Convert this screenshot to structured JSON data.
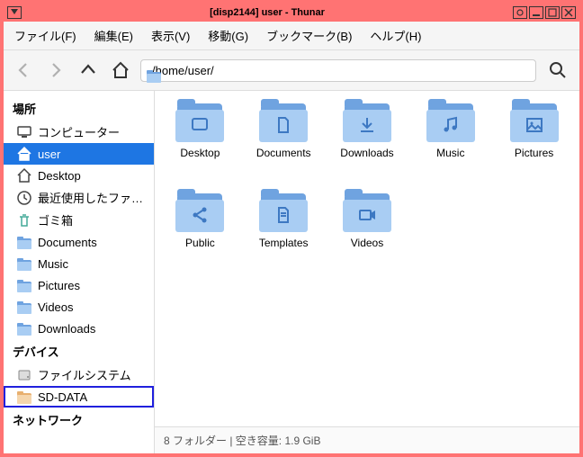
{
  "title": "[disp2144] user - Thunar",
  "menu": {
    "file": "ファイル(F)",
    "edit": "編集(E)",
    "view": "表示(V)",
    "go": "移動(G)",
    "bookmarks": "ブックマーク(B)",
    "help": "ヘルプ(H)"
  },
  "path": "/home/user/",
  "sidebar": {
    "places_header": "場所",
    "devices_header": "デバイス",
    "network_header": "ネットワーク",
    "items": [
      {
        "label": "コンピューター",
        "icon": "monitor"
      },
      {
        "label": "user",
        "icon": "home",
        "selected": true
      },
      {
        "label": "Desktop",
        "icon": "home-outline"
      },
      {
        "label": "最近使用したファ…",
        "icon": "clock"
      },
      {
        "label": "ゴミ箱",
        "icon": "trash"
      },
      {
        "label": "Documents",
        "icon": "folder"
      },
      {
        "label": "Music",
        "icon": "folder"
      },
      {
        "label": "Pictures",
        "icon": "folder"
      },
      {
        "label": "Videos",
        "icon": "folder"
      },
      {
        "label": "Downloads",
        "icon": "folder"
      }
    ],
    "devices": [
      {
        "label": "ファイルシステム",
        "icon": "disk"
      },
      {
        "label": "SD-DATA",
        "icon": "folder-orange",
        "highlighted": true
      }
    ]
  },
  "folders": [
    {
      "name": "Desktop",
      "glyph": "desktop"
    },
    {
      "name": "Documents",
      "glyph": "document"
    },
    {
      "name": "Downloads",
      "glyph": "download"
    },
    {
      "name": "Music",
      "glyph": "music"
    },
    {
      "name": "Pictures",
      "glyph": "picture"
    },
    {
      "name": "Public",
      "glyph": "share"
    },
    {
      "name": "Templates",
      "glyph": "template"
    },
    {
      "name": "Videos",
      "glyph": "video"
    }
  ],
  "status": "8 フォルダー | 空き容量: 1.9 GiB"
}
